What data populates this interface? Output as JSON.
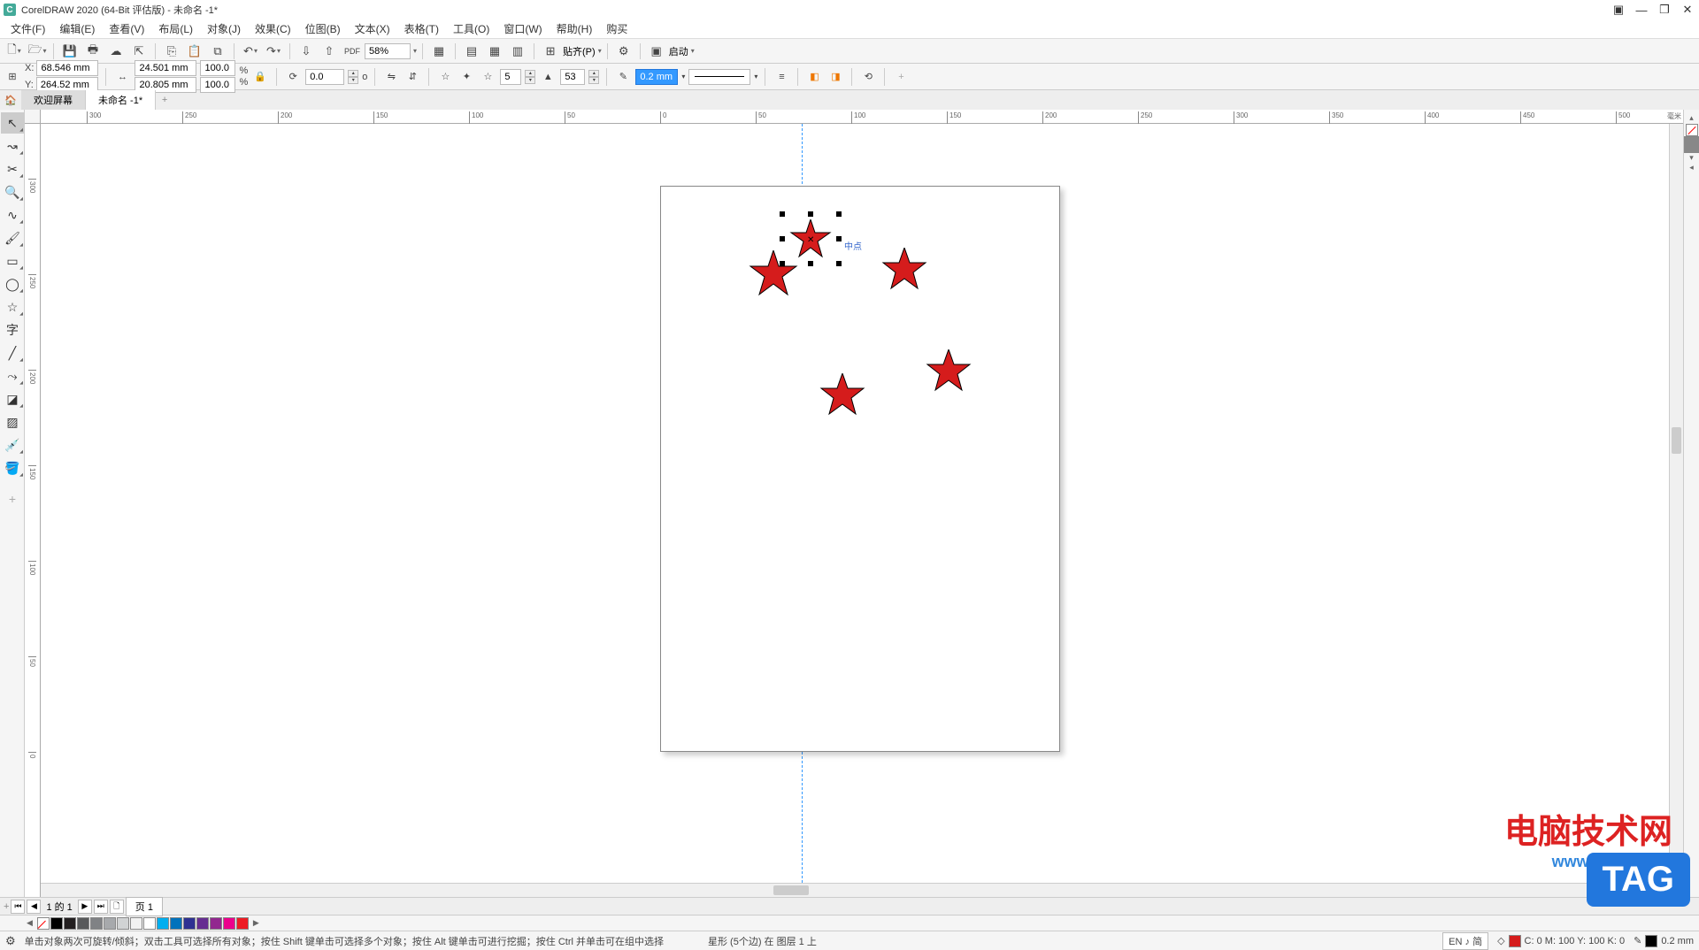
{
  "title": "CorelDRAW 2020 (64-Bit 评估版) - 未命名 -1*",
  "menu": {
    "file": "文件(F)",
    "edit": "编辑(E)",
    "view": "查看(V)",
    "layout": "布局(L)",
    "object": "对象(J)",
    "effect": "效果(C)",
    "bitmap": "位图(B)",
    "text": "文本(X)",
    "table": "表格(T)",
    "tool": "工具(O)",
    "window": "窗口(W)",
    "help": "帮助(H)",
    "buy": "购买"
  },
  "toolbar1": {
    "zoom": "58%",
    "paste_label": "贴齐(P)",
    "launch_label": "启动"
  },
  "toolbar2": {
    "x_label": "X:",
    "y_label": "Y:",
    "x": "68.546 mm",
    "y": "264.52 mm",
    "w": "24.501 mm",
    "h": "20.805 mm",
    "scale_x": "100.0",
    "scale_y": "100.0",
    "percent": "%",
    "rotation": "0.0",
    "degree": "o",
    "points": "5",
    "sharpness": "53",
    "outline_width": "0.2 mm"
  },
  "tabs": {
    "welcome": "欢迎屏幕",
    "doc": "未命名 -1*"
  },
  "ruler": {
    "unit": "毫米",
    "h_ticks": [
      "-300",
      "-250",
      "-200",
      "-150",
      "-100",
      "-50",
      "0",
      "50",
      "100",
      "150",
      "200",
      "250",
      "300",
      "350",
      "400",
      "450",
      "500"
    ],
    "v_ticks": [
      "300",
      "250",
      "200",
      "150",
      "100",
      "50",
      "0"
    ]
  },
  "selection_tooltip": "中点",
  "page_nav": {
    "counter": "1 的 1",
    "page_label": "页 1"
  },
  "statusbar": {
    "hint": "单击对象两次可旋转/倾斜；双击工具可选择所有对象；按住 Shift 键单击可选择多个对象；按住 Alt 键单击可进行挖掘；按住 Ctrl 并单击可在组中选择",
    "object_info": "星形 (5个边) 在 图层 1 上",
    "lang": "EN ♪ 简",
    "fill_info": "C: 0 M: 100 Y: 100 K: 0",
    "outline_info": "0.2 mm"
  },
  "palette_v": [
    "#000000",
    "#ffffff",
    "#00aeef",
    "#ec008c",
    "#fff200",
    "#ed1c24",
    "#2e3192",
    "#00a651",
    "#000000",
    "#ffffff",
    "#f1f1f1",
    "#d1d3d4",
    "#a7a9ac",
    "#808285",
    "#58595b",
    "#231f20",
    "#41281b",
    "#6b3f2a",
    "#8b5e3c",
    "#a97c50",
    "#c49a6c",
    "#e0c097",
    "#f2e2c4",
    "#fef4e8",
    "#fffde7",
    "#fff9c4",
    "#fff176",
    "#ffeb3b",
    "#ffc107",
    "#ff9800",
    "#ff5722",
    "#f44336",
    "#e91e63",
    "#9c27b0",
    "#673ab7",
    "#3f51b5",
    "#2196f3",
    "#03a9f4",
    "#00bcd4",
    "#009688",
    "#4caf50",
    "#8bc34a"
  ],
  "doc_palette": [
    "#000000",
    "#231f20",
    "#58595b",
    "#808285",
    "#a7a9ac",
    "#d1d3d4",
    "#f1f1f1",
    "#ffffff",
    "#00aeef",
    "#0072bc",
    "#2e3192",
    "#662d91",
    "#92278f",
    "#ec008c",
    "#ed1c24"
  ],
  "watermark": {
    "text": "电脑技术网",
    "url": "www.tagxp.com"
  },
  "tag_badge": "TAG"
}
